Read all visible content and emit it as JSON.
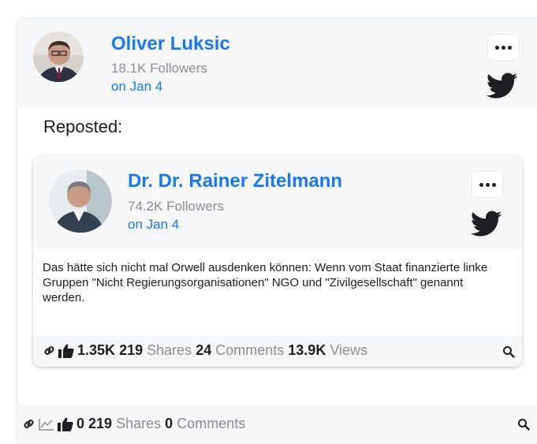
{
  "post": {
    "author": "Oliver Luksic",
    "followers": "18.1K Followers",
    "date": "on Jan 4",
    "reposted_label": "Reposted:",
    "stats": {
      "likes": "0",
      "shares_count": "219",
      "shares_label": "Shares",
      "comments_count": "0",
      "comments_label": "Comments"
    }
  },
  "repost": {
    "author": "Dr. Dr. Rainer Zitelmann",
    "followers": "74.2K Followers",
    "date": "on Jan 4",
    "text": "Das hätte sich nicht mal Orwell ausdenken können: Wenn vom Staat finanzierte linke Gruppen \"Nicht Regierungsorganisationen\" NGO und \"Zivilgesellschaft\" genannt werden.",
    "stats": {
      "likes": "1.35K",
      "shares_count": "219",
      "shares_label": "Shares",
      "comments_count": "24",
      "comments_label": "Comments",
      "views_count": "13.9K",
      "views_label": "Views"
    }
  },
  "colors": {
    "link": "#1878f2",
    "muted": "#8a8d91",
    "header_bg": "#f6f7f8",
    "text": "#1c1e21"
  },
  "icons": [
    "more-icon",
    "twitter-icon",
    "link-icon",
    "thumbs-up-icon",
    "chart-icon",
    "search-icon"
  ]
}
